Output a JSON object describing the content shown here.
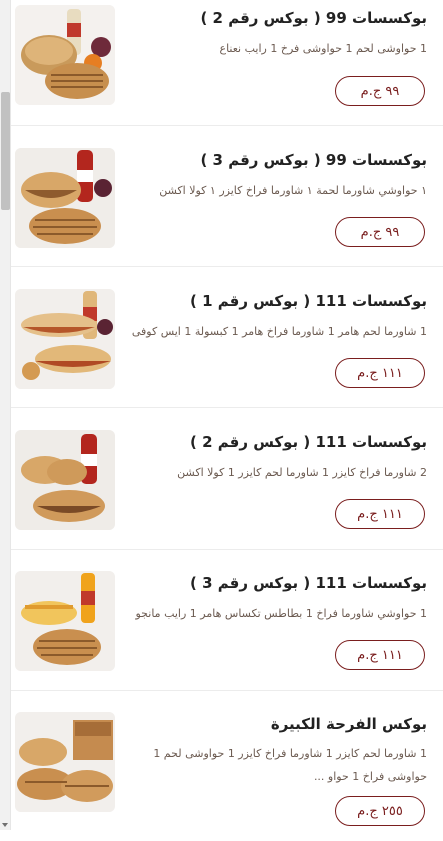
{
  "menu_items": [
    {
      "title": "بوكسسات 99 ( بوكس رقم 2 )",
      "desc": "1 حواوشى لحم 1 حواوشى فرخ 1 رايب نعناع",
      "price": "٩٩ ج.م"
    },
    {
      "title": "بوكسسات 99 ( بوكس رقم 3 )",
      "desc": "١ حواوشي شاورما لحمة ١ شاورما فراخ كايزر ١ كولا اكشن",
      "price": "٩٩ ج.م"
    },
    {
      "title": "بوكسسات 111 ( بوكس رقم 1 )",
      "desc": "1 شاورما لحم هامر 1 شاورما فراخ هامر 1 كبسولة 1 ايس كوفى",
      "price": "١١١ ج.م"
    },
    {
      "title": "بوكسسات 111 ( بوكس رقم 2 )",
      "desc": "2 شاورما فراخ كايزر 1 شاورما لحم كايزر 1 كولا اكشن",
      "price": "١١١ ج.م"
    },
    {
      "title": "بوكسسات 111 ( بوكس رقم 3 )",
      "desc": "1 حواوشي شاورما فراخ 1 بطاطس تكساس هامر 1 رايب مانجو",
      "price": "١١١ ج.م"
    },
    {
      "title": "بوكس الفرحة الكبيرة",
      "desc": "1 شاورما لحم كايزر 1 شاورما فراخ كايزر 1 حواوشى لحم 1 حواوشى فراخ 1 حواو ...",
      "price": "٢٥٥ ج.م"
    }
  ],
  "colors": {
    "accent": "#7a1e1e",
    "text": "#222222",
    "desc": "#6b5a50",
    "divider": "#ececec"
  }
}
